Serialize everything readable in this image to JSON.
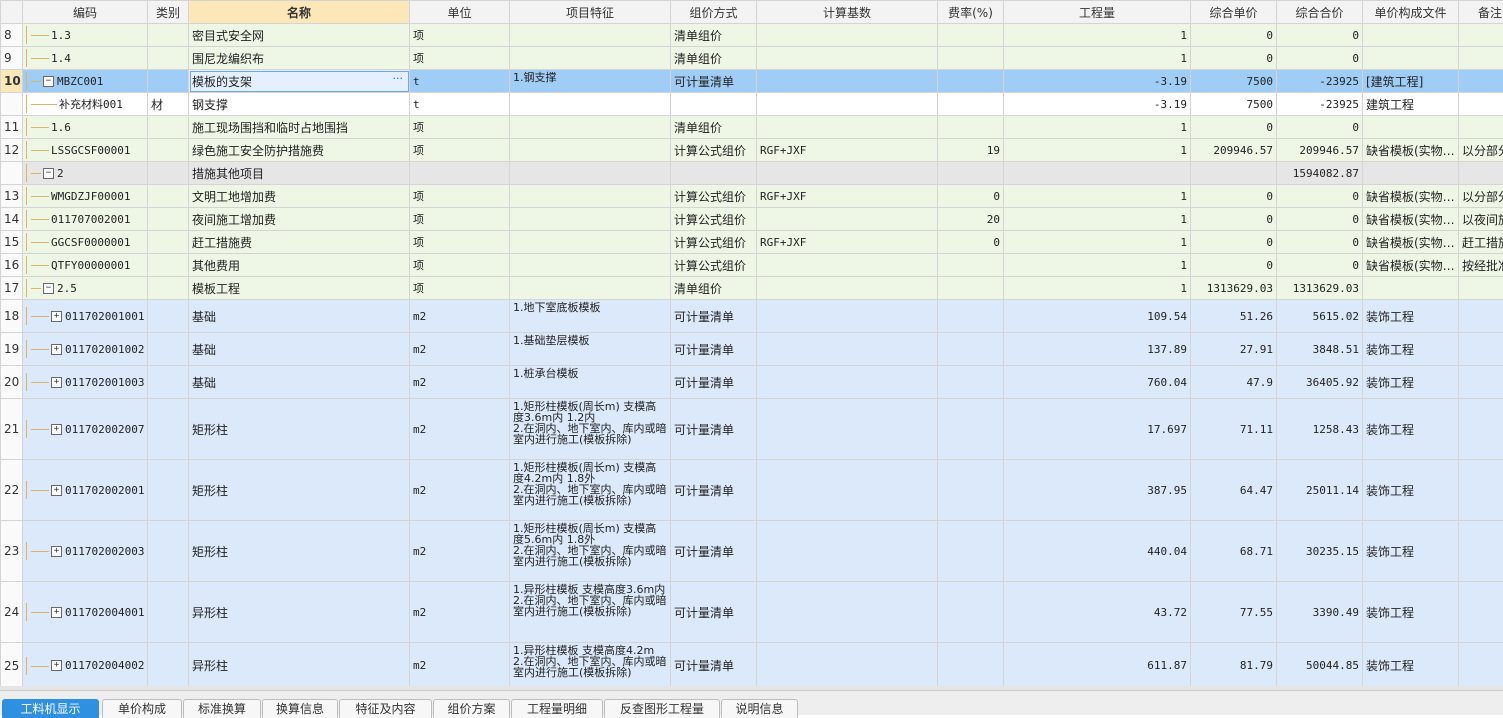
{
  "columns": [
    "",
    "编码",
    "类别",
    "名称",
    "单位",
    "项目特征",
    "组价方式",
    "计算基数",
    "费率(%)",
    "工程量",
    "综合单价",
    "综合合价",
    "单价构成文件",
    "备注"
  ],
  "rows": [
    {
      "rn": "8",
      "level": 2,
      "box": "",
      "code": "1.3",
      "type": "",
      "name": "密目式安全网",
      "unit": "项",
      "feat": "",
      "method": "清单组价",
      "base": "",
      "rate": "",
      "qty": "1",
      "price": "0",
      "total": "0",
      "file": "",
      "note": "",
      "style": "green",
      "h": 23
    },
    {
      "rn": "9",
      "level": 2,
      "box": "",
      "code": "1.4",
      "type": "",
      "name": "围尼龙编织布",
      "unit": "项",
      "feat": "",
      "method": "清单组价",
      "base": "",
      "rate": "",
      "qty": "1",
      "price": "0",
      "total": "0",
      "file": "",
      "note": "",
      "style": "green",
      "h": 23
    },
    {
      "rn": "10",
      "level": 1,
      "box": "−",
      "code": "MBZC001",
      "type": "",
      "name": "模板的支架",
      "unit": "t",
      "feat": "1.钢支撑",
      "method": "可计量清单",
      "base": "",
      "rate": "",
      "qty": "-3.19",
      "price": "7500",
      "total": "-23925",
      "file": "[建筑工程]",
      "note": "",
      "style": "sel",
      "h": 23
    },
    {
      "rn": "",
      "level": 3,
      "box": "",
      "code": "补充材料001",
      "type": "材",
      "name": "钢支撑",
      "unit": "t",
      "feat": "",
      "method": "",
      "base": "",
      "rate": "",
      "qty": "-3.19",
      "price": "7500",
      "total": "-23925",
      "file": "建筑工程",
      "note": "",
      "style": "white",
      "h": 23
    },
    {
      "rn": "11",
      "level": 2,
      "box": "",
      "code": "1.6",
      "type": "",
      "name": "施工现场围挡和临时占地围挡",
      "unit": "项",
      "feat": "",
      "method": "清单组价",
      "base": "",
      "rate": "",
      "qty": "1",
      "price": "0",
      "total": "0",
      "file": "",
      "note": "",
      "style": "green",
      "h": 23
    },
    {
      "rn": "12",
      "level": 2,
      "box": "",
      "code": "LSSGCSF00001",
      "type": "",
      "name": "绿色施工安全防护措施费",
      "unit": "项",
      "feat": "",
      "method": "计算公式组价",
      "base": "RGF+JXF",
      "rate": "19",
      "qty": "1",
      "price": "209946.57",
      "total": "209946.57",
      "file": "缺省模板(实物…",
      "note": "以分部分",
      "style": "green",
      "h": 23
    },
    {
      "rn": "",
      "level": 1,
      "box": "−",
      "code": "2",
      "type": "",
      "name": "措施其他项目",
      "unit": "",
      "feat": "",
      "method": "",
      "base": "",
      "rate": "",
      "qty": "",
      "price": "",
      "total": "1594082.87",
      "file": "",
      "note": "",
      "style": "grey",
      "h": 23
    },
    {
      "rn": "13",
      "level": 2,
      "box": "",
      "code": "WMGDZJF00001",
      "type": "",
      "name": "文明工地增加费",
      "unit": "项",
      "feat": "",
      "method": "计算公式组价",
      "base": "RGF+JXF",
      "rate": "0",
      "qty": "1",
      "price": "0",
      "total": "0",
      "file": "缺省模板(实物…",
      "note": "以分部分",
      "style": "green",
      "h": 23
    },
    {
      "rn": "14",
      "level": 2,
      "box": "",
      "code": "011707002001",
      "type": "",
      "name": "夜间施工增加费",
      "unit": "项",
      "feat": "",
      "method": "计算公式组价",
      "base": "",
      "rate": "20",
      "qty": "1",
      "price": "0",
      "total": "0",
      "file": "缺省模板(实物…",
      "note": "以夜间施",
      "style": "green",
      "h": 23
    },
    {
      "rn": "15",
      "level": 2,
      "box": "",
      "code": "GGCSF0000001",
      "type": "",
      "name": "赶工措施费",
      "unit": "项",
      "feat": "",
      "method": "计算公式组价",
      "base": "RGF+JXF",
      "rate": "0",
      "qty": "1",
      "price": "0",
      "total": "0",
      "file": "缺省模板(实物…",
      "note": "赶工措施",
      "style": "green",
      "h": 23
    },
    {
      "rn": "16",
      "level": 2,
      "box": "",
      "code": "QTFY00000001",
      "type": "",
      "name": "其他费用",
      "unit": "项",
      "feat": "",
      "method": "计算公式组价",
      "base": "",
      "rate": "",
      "qty": "1",
      "price": "0",
      "total": "0",
      "file": "缺省模板(实物…",
      "note": "按经批准",
      "style": "green",
      "h": 23
    },
    {
      "rn": "17",
      "level": 1,
      "box": "−",
      "code": "2.5",
      "type": "",
      "name": "模板工程",
      "unit": "项",
      "feat": "",
      "method": "清单组价",
      "base": "",
      "rate": "",
      "qty": "1",
      "price": "1313629.03",
      "total": "1313629.03",
      "file": "",
      "note": "",
      "style": "green",
      "h": 23
    },
    {
      "rn": "18",
      "level": 2,
      "box": "+",
      "code": "011702001001",
      "type": "",
      "name": "基础",
      "unit": "m2",
      "feat": "1.地下室底板模板",
      "method": "可计量清单",
      "base": "",
      "rate": "",
      "qty": "109.54",
      "price": "51.26",
      "total": "5615.02",
      "file": "装饰工程",
      "note": "",
      "style": "blue",
      "h": 33
    },
    {
      "rn": "19",
      "level": 2,
      "box": "+",
      "code": "011702001002",
      "type": "",
      "name": "基础",
      "unit": "m2",
      "feat": "1.基础垫层模板",
      "method": "可计量清单",
      "base": "",
      "rate": "",
      "qty": "137.89",
      "price": "27.91",
      "total": "3848.51",
      "file": "装饰工程",
      "note": "",
      "style": "blue",
      "h": 33
    },
    {
      "rn": "20",
      "level": 2,
      "box": "+",
      "code": "011702001003",
      "type": "",
      "name": "基础",
      "unit": "m2",
      "feat": "1.桩承台模板",
      "method": "可计量清单",
      "base": "",
      "rate": "",
      "qty": "760.04",
      "price": "47.9",
      "total": "36405.92",
      "file": "装饰工程",
      "note": "",
      "style": "blue",
      "h": 33
    },
    {
      "rn": "21",
      "level": 2,
      "box": "+",
      "code": "011702002007",
      "type": "",
      "name": "矩形柱",
      "unit": "m2",
      "feat": "1.矩形柱模板(周长m) 支模高度3.6m内 1.2内\n2.在洞内、地下室内、库内或暗室内进行施工(模板拆除)",
      "method": "可计量清单",
      "base": "",
      "rate": "",
      "qty": "17.697",
      "price": "71.11",
      "total": "1258.43",
      "file": "装饰工程",
      "note": "",
      "style": "blue",
      "h": 61
    },
    {
      "rn": "22",
      "level": 2,
      "box": "+",
      "code": "011702002001",
      "type": "",
      "name": "矩形柱",
      "unit": "m2",
      "feat": "1.矩形柱模板(周长m) 支模高度4.2m内 1.8外\n2.在洞内、地下室内、库内或暗室内进行施工(模板拆除)",
      "method": "可计量清单",
      "base": "",
      "rate": "",
      "qty": "387.95",
      "price": "64.47",
      "total": "25011.14",
      "file": "装饰工程",
      "note": "",
      "style": "blue",
      "h": 61
    },
    {
      "rn": "23",
      "level": 2,
      "box": "+",
      "code": "011702002003",
      "type": "",
      "name": "矩形柱",
      "unit": "m2",
      "feat": "1.矩形柱模板(周长m) 支模高度5.6m内 1.8外\n2.在洞内、地下室内、库内或暗室内进行施工(模板拆除)",
      "method": "可计量清单",
      "base": "",
      "rate": "",
      "qty": "440.04",
      "price": "68.71",
      "total": "30235.15",
      "file": "装饰工程",
      "note": "",
      "style": "blue",
      "h": 61
    },
    {
      "rn": "24",
      "level": 2,
      "box": "+",
      "code": "011702004001",
      "type": "",
      "name": "异形柱",
      "unit": "m2",
      "feat": "1.异形柱模板 支模高度3.6m内\n2.在洞内、地下室内、库内或暗室内进行施工(模板拆除)",
      "method": "可计量清单",
      "base": "",
      "rate": "",
      "qty": "43.72",
      "price": "77.55",
      "total": "3390.49",
      "file": "装饰工程",
      "note": "",
      "style": "blue",
      "h": 61
    },
    {
      "rn": "25",
      "level": 2,
      "box": "+",
      "code": "011702004002",
      "type": "",
      "name": "异形柱",
      "unit": "m2",
      "feat": "1.异形柱模板 支模高度4.2m\n2.在洞内、地下室内、库内或暗室内进行施工(模板拆除)",
      "method": "可计量清单",
      "base": "",
      "rate": "",
      "qty": "611.87",
      "price": "81.79",
      "total": "50044.85",
      "file": "装饰工程",
      "note": "",
      "style": "blue",
      "h": 46
    }
  ],
  "tabs": [
    "工料机显示",
    "单价构成",
    "标准换算",
    "换算信息",
    "特征及内容",
    "组价方案",
    "工程量明细",
    "反查图形工程量",
    "说明信息"
  ],
  "active_tab": 0,
  "colors": {
    "header_highlight": "#fbe7b8",
    "selected_row": "#9fcdf5",
    "tab_active": "#2f8fe0"
  }
}
